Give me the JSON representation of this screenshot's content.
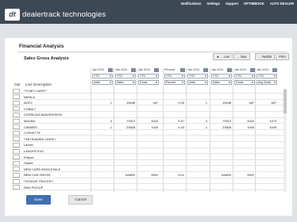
{
  "app": {
    "logo_mark": "dt",
    "brand_name": "dealertrack technologies",
    "top_links": [
      "Notifications",
      "Settings",
      "Support",
      "OPTIMBOOK",
      "AUTO DEALER"
    ]
  },
  "page": {
    "title": "Financial Analysis",
    "subtitle": "Sales Gross Analysis",
    "controls": [
      "◄ → Lev",
      "→ Nav",
      "→ NetDS",
      "Print"
    ]
  },
  "columns": [
    {
      "date": "Jan 2011",
      "period": "YTD",
      "metric": "Units"
    },
    {
      "date": "Jan 2011",
      "period": "YTD",
      "metric": "Sales"
    },
    {
      "date": "Jan 2011",
      "period": "YTD",
      "metric": "Gross"
    },
    {
      "date": "Percent",
      "period": "YTD",
      "metric": "Percent"
    },
    {
      "date": "Jan 2011",
      "period": "YTD",
      "metric": "Units"
    },
    {
      "date": "Jan 2011",
      "period": "YTD",
      "metric": "Sales"
    },
    {
      "date": "Jan 2011",
      "period": "YTD",
      "metric": "Gross"
    },
    {
      "date": "Jan 2011",
      "period": "YTD",
      "metric": "Avg Gross"
    }
  ],
  "table": {
    "opt_header": "Opt",
    "line_header": "Line Description",
    "rows": [
      {
        "label": "**CHEV CARS**",
        "values": [
          "",
          "",
          "",
          "",
          "",
          "",
          "",
          ""
        ]
      },
      {
        "label": "IMPALA",
        "values": [
          "",
          "",
          "",
          "",
          "",
          "",
          "",
          ""
        ]
      },
      {
        "label": "AVEO",
        "values": [
          "1",
          "15948",
          "487",
          "3.05",
          "1",
          "15948",
          "487",
          "487"
        ]
      },
      {
        "label": "COBALT",
        "values": [
          "",
          "",
          "",
          "",
          "",
          "",
          "",
          ""
        ]
      },
      {
        "label": "CORSICA/CAVALIER/SION",
        "values": [
          "",
          "",
          "",
          "",
          "",
          "",
          "",
          ""
        ]
      },
      {
        "label": "MALIBU",
        "values": [
          "3",
          "79313",
          "4420",
          "5.57",
          "3",
          "79313",
          "4420",
          "1473"
        ]
      },
      {
        "label": "CAMARO",
        "values": [
          "1",
          "23508",
          "1045",
          "4.43",
          "1",
          "23508",
          "1045",
          "1045"
        ]
      },
      {
        "label": "CORVETTE",
        "values": [
          "",
          "",
          "",
          "",
          "",
          "",
          "",
          ""
        ]
      },
      {
        "label": "**MITSUBISHI CARS**",
        "values": [
          "",
          "",
          "",
          "",
          "",
          "",
          "",
          ""
        ]
      },
      {
        "label": "Lancer",
        "values": [
          "",
          "",
          "",
          "",
          "",
          "",
          "",
          ""
        ]
      },
      {
        "label": "LANCER EVO",
        "values": [
          "",
          "",
          "",
          "",
          "",
          "",
          "",
          ""
        ]
      },
      {
        "label": "Eclipse",
        "values": [
          "",
          "",
          "",
          "",
          "",
          "",
          "",
          ""
        ]
      },
      {
        "label": "Galant",
        "values": [
          "",
          "",
          "",
          "",
          "",
          "",
          "",
          ""
        ]
      },
      {
        "label": "NEW CARS WHOLESALE",
        "values": [
          "",
          "",
          "",
          "",
          "",
          "",
          "",
          ""
        ]
      },
      {
        "label": "NEW CAR GROSS",
        "values": [
          "",
          "118800",
          "5902",
          "5.01",
          "",
          "118800",
          "5902",
          ""
        ]
      },
      {
        "label": "**DODGE TRUCKS**",
        "values": [
          "",
          "",
          "",
          "",
          "",
          "",
          "",
          ""
        ]
      },
      {
        "label": "RAM PICKUP",
        "values": [
          "",
          "",
          "",
          "",
          "",
          "",
          "",
          ""
        ]
      }
    ]
  },
  "buttons": {
    "save": "Save",
    "cancel": "Cancel"
  },
  "colors": {
    "topbar": "#3d4855",
    "primary_button": "#3f6fb0",
    "background": "#dfe2e6"
  }
}
